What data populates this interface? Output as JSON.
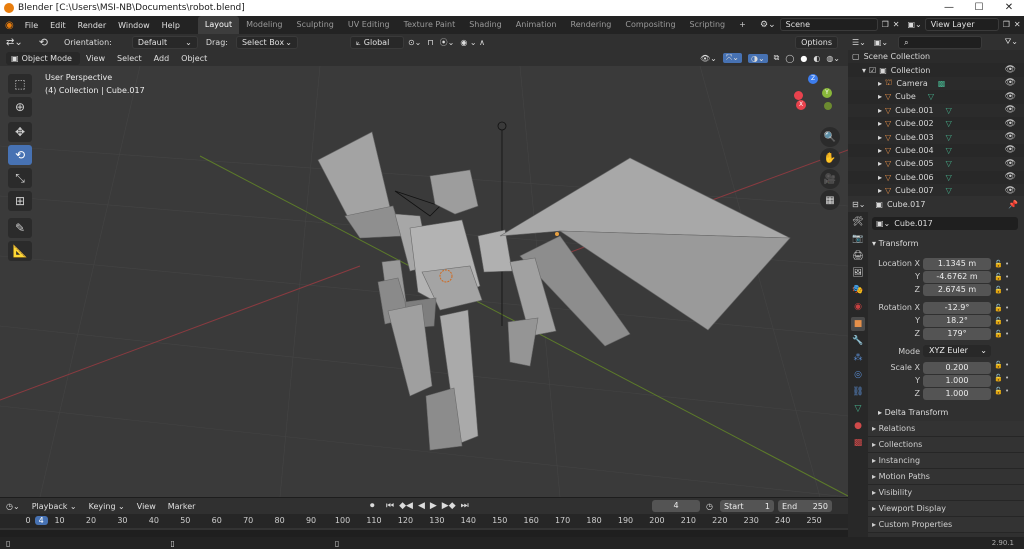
{
  "window": {
    "title": "Blender [C:\\Users\\MSI-NB\\Documents\\robot.blend]"
  },
  "menubar": {
    "menus": [
      "File",
      "Edit",
      "Render",
      "Window",
      "Help"
    ],
    "workspaces": [
      "Layout",
      "Modeling",
      "Sculpting",
      "UV Editing",
      "Texture Paint",
      "Shading",
      "Animation",
      "Rendering",
      "Compositing",
      "Scripting"
    ],
    "add_tab": "+",
    "scene": "Scene",
    "view_layer": "View Layer"
  },
  "header": {
    "orientation_label": "Orientation:",
    "orientation_value": "Default",
    "drag_label": "Drag:",
    "drag_value": "Select Box",
    "transform_orientation": "Global",
    "options": "Options"
  },
  "viewport_header": {
    "mode": "Object Mode",
    "menus": [
      "View",
      "Select",
      "Add",
      "Object"
    ]
  },
  "viewport": {
    "view_name": "User Perspective",
    "context": "(4) Collection | Cube.017"
  },
  "gizmo": {
    "x": "X",
    "y": "Y",
    "z": "Z"
  },
  "outliner": {
    "root": "Scene Collection",
    "collection": "Collection",
    "items": [
      "Camera",
      "Cube",
      "Cube.001",
      "Cube.002",
      "Cube.003",
      "Cube.004",
      "Cube.005",
      "Cube.006",
      "Cube.007"
    ]
  },
  "properties": {
    "object_name": "Cube.017",
    "transform_title": "Transform",
    "location_label": "Location X",
    "rotation_label": "Rotation X",
    "scale_label": "Scale X",
    "y_label": "Y",
    "z_label": "Z",
    "location": [
      "1.1345 m",
      "-4.6762 m",
      "2.6745 m"
    ],
    "rotation": [
      "-12.9°",
      "18.2°",
      "179°"
    ],
    "mode_label": "Mode",
    "mode_value": "XYZ Euler",
    "scale": [
      "0.200",
      "1.000",
      "1.000"
    ],
    "delta_transform": "Delta Transform",
    "sections": [
      "Relations",
      "Collections",
      "Instancing",
      "Motion Paths",
      "Visibility",
      "Viewport Display",
      "Custom Properties"
    ]
  },
  "timeline": {
    "menus": [
      "Playback",
      "Keying",
      "View",
      "Marker"
    ],
    "current_frame": "4",
    "start_label": "Start",
    "start": "1",
    "end_label": "End",
    "end": "250",
    "ruler": [
      "0",
      "4",
      "10",
      "20",
      "30",
      "40",
      "50",
      "60",
      "70",
      "80",
      "90",
      "100",
      "110",
      "120",
      "130",
      "140",
      "150",
      "160",
      "170",
      "180",
      "190",
      "200",
      "210",
      "220",
      "230",
      "240",
      "250"
    ]
  },
  "status": {
    "version": "2.90.1"
  },
  "colors": {
    "accent": "#4772b3",
    "workspace_active": "#3d3d3d",
    "x_axis": "#e8424d",
    "y_axis": "#8ab83a",
    "z_axis": "#3d7ded",
    "frame_marker": "#4772b3"
  }
}
